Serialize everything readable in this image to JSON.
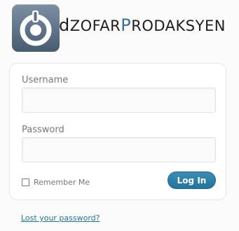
{
  "brand": {
    "logo_part1": "d",
    "logo_part2": "ZOFAR",
    "logo_part3": "P",
    "logo_part4": "RODAKSYEN",
    "icon": "camera-lens-icon"
  },
  "login_form": {
    "username_label": "Username",
    "username_value": "",
    "password_label": "Password",
    "password_value": "",
    "remember_label": "Remember Me",
    "remember_checked": false,
    "submit_label": "Log In"
  },
  "links": {
    "lost_password": "Lost your password?"
  },
  "colors": {
    "accent": "#21759b",
    "logo_blue": "#3d6fa1",
    "label_gray": "#777777"
  }
}
